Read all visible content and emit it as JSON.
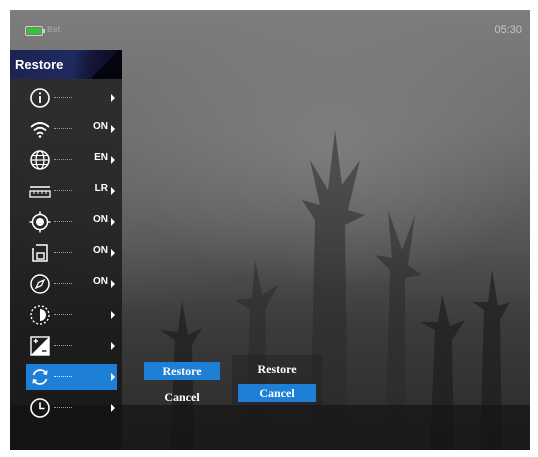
{
  "status": {
    "battery_label": "Bat",
    "time": "05:30"
  },
  "menu": {
    "title": "Restore",
    "items": [
      {
        "icon": "info-icon",
        "value": ""
      },
      {
        "icon": "wifi-icon",
        "value": "ON"
      },
      {
        "icon": "language-globe-icon",
        "value": "EN"
      },
      {
        "icon": "ruler-icon",
        "value": "LR"
      },
      {
        "icon": "target-icon",
        "value": "ON"
      },
      {
        "icon": "picture-in-picture-icon",
        "value": "ON"
      },
      {
        "icon": "compass-icon",
        "value": "ON"
      },
      {
        "icon": "half-circle-brightness-icon",
        "value": ""
      },
      {
        "icon": "contrast-icon",
        "value": ""
      },
      {
        "icon": "restore-refresh-icon",
        "value": "",
        "selected": true
      },
      {
        "icon": "clock-icon",
        "value": ""
      }
    ]
  },
  "dialog_a": {
    "restore_label": "Restore",
    "cancel_label": "Cancel",
    "highlighted": "restore"
  },
  "dialog_b": {
    "restore_label": "Restore",
    "cancel_label": "Cancel",
    "highlighted": "cancel"
  },
  "colors": {
    "accent": "#1e7fd6",
    "menu_header": "#1f2a60",
    "battery": "#35c435"
  }
}
